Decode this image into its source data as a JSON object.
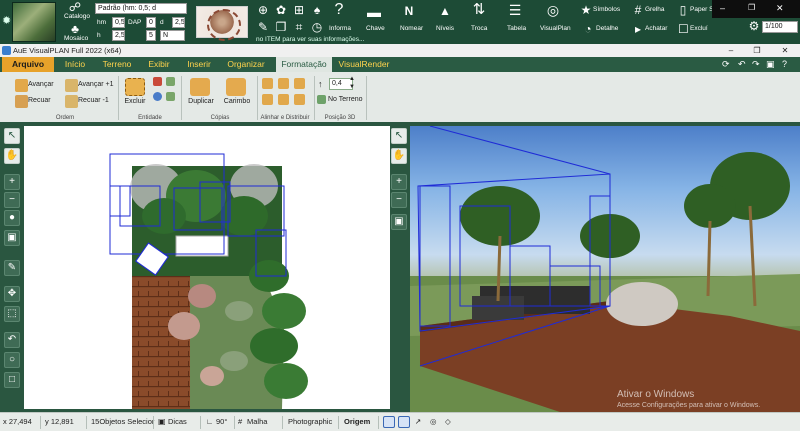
{
  "topbar": {
    "catalog_label": "Catalogo",
    "mosaic_label": "Mosaico",
    "style_select": "Padrão (hm: 0,5; d",
    "hm_label": "hm",
    "hm_value": "0,5",
    "dap_label": "DAP",
    "dap_value": "0",
    "d_label": "d",
    "d_value": "2,5",
    "h_label": "h",
    "h_value": "2,5",
    "n5_value": "5",
    "n_value": "N",
    "info_label": "Informa",
    "key_label": "Chave",
    "name_label": "Nomear",
    "levels_label": "Níveis",
    "swap_label": "Troca",
    "table_label": "Tabela",
    "visualplan_label": "VisualPlan",
    "symbols_label": "Símbolos",
    "grid_label": "Grelha",
    "paper_label": "Paper S",
    "detail_label": "Detalhe",
    "find_label": "Achatar",
    "exclude_label": "Excluí",
    "scale_value": "1/100",
    "hint": "no ITEM para ver suas informações..."
  },
  "window": {
    "title": "AuE VisualPLAN Full 2022 (x64)",
    "min": "–",
    "max": "❐",
    "close": "✕"
  },
  "tabs": [
    "Arquivo",
    "Início",
    "Terreno",
    "Exibir",
    "Inserir",
    "Organizar",
    "Formatação",
    "VisualRender"
  ],
  "ribbon": {
    "advance": "Avançar",
    "advance1": "Avançar +1",
    "back": "Recuar",
    "back1": "Recuar -1",
    "group_order": "Ordem",
    "exclude": "Excluir",
    "group_entity": "Entidade",
    "duplicate": "Duplicar",
    "stamp": "Carimbo",
    "group_copies": "Cópias",
    "group_align": "Alinhar e Distribuir",
    "pos_value": "0,4",
    "on_terrain": "No Terreno",
    "group_pos3d": "Posição 3D"
  },
  "status": {
    "x": "x 27,494",
    "y": "y 12,891",
    "selected": "15Objetos Selecior",
    "tips": "Dicas",
    "angle": "90°",
    "grid": "Malha",
    "render": "Photographic",
    "origin": "Origem"
  },
  "watermark": {
    "line1": "Ativar o Windows",
    "line2": "Acesse Configurações para ativar o Windows."
  }
}
